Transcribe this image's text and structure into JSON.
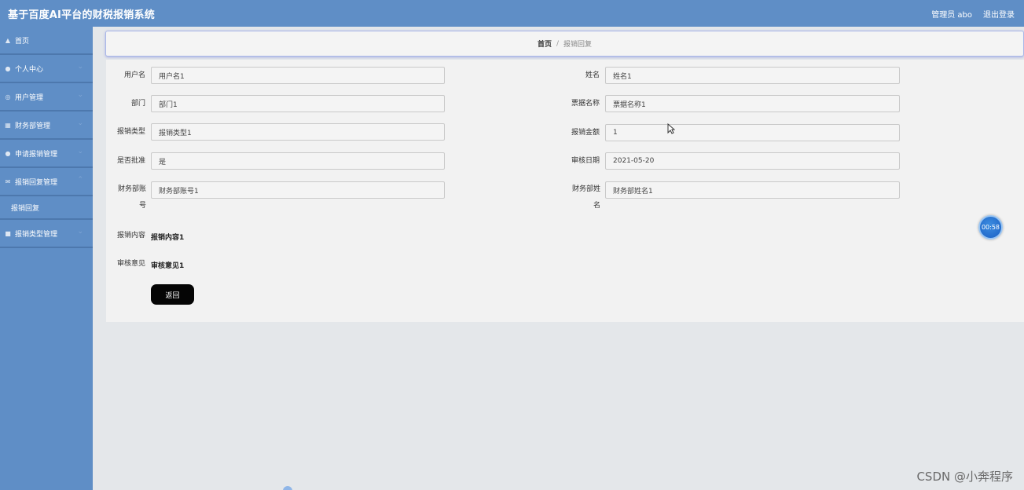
{
  "header": {
    "app_title": "基于百度AI平台的财税报销系统",
    "user": "管理员 abo",
    "logout": "退出登录"
  },
  "sidebar": {
    "items": [
      {
        "icon": "home-icon",
        "label": "首页"
      },
      {
        "icon": "user-icon",
        "label": "个人中心"
      },
      {
        "icon": "mic-icon",
        "label": "用户管理"
      },
      {
        "icon": "grid-icon",
        "label": "财务部管理"
      },
      {
        "icon": "person-icon",
        "label": "申请报销管理"
      },
      {
        "icon": "mail-icon",
        "label": "报销回复管理"
      },
      {
        "icon": "trash-icon",
        "label": "报销类型管理"
      }
    ],
    "submenu": {
      "label": "报销回复"
    }
  },
  "breadcrumb": {
    "home": "首页",
    "sep": "/",
    "current": "报销回复"
  },
  "form": {
    "username": {
      "label": "用户名",
      "value": "用户名1"
    },
    "name": {
      "label": "姓名",
      "value": "姓名1"
    },
    "dept": {
      "label": "部门",
      "value": "部门1"
    },
    "receipt": {
      "label": "票据名称",
      "value": "票据名称1"
    },
    "type": {
      "label": "报销类型",
      "value": "报销类型1"
    },
    "amount": {
      "label": "报销金额",
      "value": "1"
    },
    "approved": {
      "label": "是否批准",
      "value": "是"
    },
    "review_date": {
      "label": "审核日期",
      "value": "2021-05-20"
    },
    "finance_account": {
      "label": "财务部账号",
      "value": "财务部账号1"
    },
    "finance_name": {
      "label": "财务部姓名",
      "value": "财务部姓名1"
    },
    "content": {
      "label": "报销内容",
      "value": "报销内容1"
    },
    "opinion": {
      "label": "审核意见",
      "value": "审核意见1"
    },
    "back_button": "返回"
  },
  "timer": {
    "text": "00:58"
  },
  "watermark": {
    "text": "CSDN @小奔程序"
  }
}
